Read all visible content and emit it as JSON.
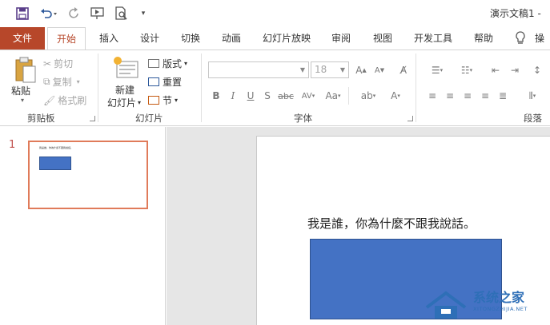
{
  "window": {
    "title": "演示文稿1  -"
  },
  "tabs": [
    "文件",
    "开始",
    "插入",
    "设计",
    "切换",
    "动画",
    "幻灯片放映",
    "审阅",
    "视图",
    "开发工具",
    "帮助",
    "操"
  ],
  "clipboard": {
    "paste": "粘贴",
    "cut": "剪切",
    "copy": "复制",
    "format_painter": "格式刷",
    "group_label": "剪贴板"
  },
  "slides_group": {
    "new_slide_line1": "新建",
    "new_slide_line2": "幻灯片",
    "layout": "版式",
    "reset": "重置",
    "section": "节",
    "group_label": "幻灯片"
  },
  "font_group": {
    "font_size": "18",
    "group_label": "字体"
  },
  "paragraph_group": {
    "group_label": "段落"
  },
  "thumbnail": {
    "number": "1"
  },
  "slide": {
    "text": "我是誰，你為什麼不跟我說話。",
    "rect_color": "#4472c4"
  },
  "watermark": {
    "title": "系统之家",
    "subtitle": "XITONGZHIJIA.NET"
  },
  "colors": {
    "file_tab": "#b7472a",
    "accent": "#b7472a",
    "thumb_border": "#e07b5a"
  }
}
